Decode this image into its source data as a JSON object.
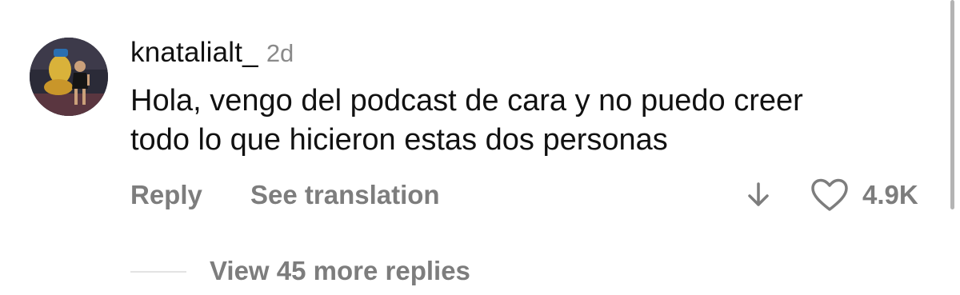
{
  "comment": {
    "username": "knatalialt_",
    "timestamp": "2d",
    "text_lines": [
      "Hola, vengo del podcast de cara y no puedo creer",
      "todo lo que hicieron estas dos personas"
    ],
    "actions": {
      "reply_label": "Reply",
      "translate_label": "See translation"
    },
    "like_count": "4.9K",
    "icons": {
      "avatar": "profile-photo",
      "dislike": "arrow-down-icon",
      "like": "heart-outline-icon"
    }
  },
  "replies": {
    "view_more_label": "View 45 more replies"
  },
  "colors": {
    "primary_text": "#111111",
    "secondary_text": "#7d7d7d",
    "timestamp": "#8a8a8a",
    "divider": "#e3e3e3",
    "background": "#ffffff"
  }
}
